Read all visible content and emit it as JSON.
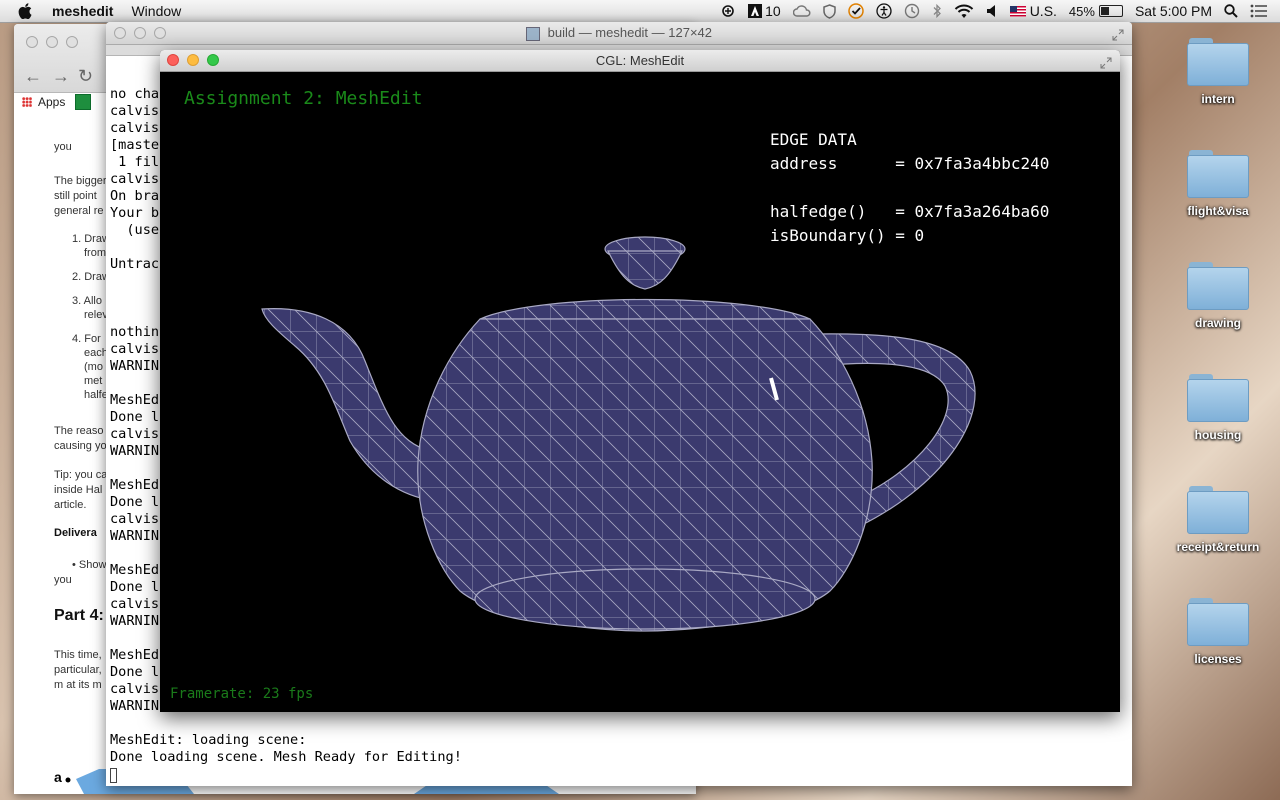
{
  "menubar": {
    "app_name": "meshedit",
    "items": [
      "Window"
    ],
    "status": {
      "adobe_count": "10",
      "input_source": "U.S.",
      "battery": "45%",
      "battery_level": 0.45,
      "clock": "Sat 5:00 PM"
    }
  },
  "desktop": {
    "folders": [
      "intern",
      "flight&visa",
      "drawing",
      "housing",
      "receipt&return",
      "licenses"
    ]
  },
  "browser": {
    "bookmarks_apps": "Apps",
    "lines": [
      "you",
      "The bigger",
      "still point",
      "general re",
      "1. Draw",
      "from",
      "2. Draw",
      "3. Allo",
      "relev",
      "4. For",
      "each",
      "(mo",
      "met",
      "halfe",
      "The reaso",
      "causing yo",
      "Tip: you ca",
      "inside Hal",
      "article.",
      "Delivera",
      "•  Show",
      "you",
      "Part 4:",
      "This time,",
      "particular,",
      "m at its m"
    ],
    "bottom_label": "a"
  },
  "terminal": {
    "title": "build — meshedit — 127×42",
    "lines": [
      "no cha",
      "calvis",
      "calvis",
      "[maste",
      " 1 fil",
      "calvis",
      "On bra",
      "Your b",
      "  (use",
      "",
      "Untrac",
      "",
      "",
      "",
      "nothin",
      "calvis",
      "WARNIN",
      "",
      "MeshEd",
      "Done l",
      "calvis",
      "WARNIN",
      "",
      "MeshEd",
      "Done l",
      "calvis",
      "WARNIN",
      "",
      "MeshEd",
      "Done l",
      "calvis",
      "WARNIN",
      "",
      "MeshEd",
      "Done l",
      "calvis",
      "WARNIN",
      "",
      "MeshEdit: loading scene:",
      "Done loading scene. Mesh Ready for Editing!"
    ]
  },
  "cgl": {
    "title": "CGL: MeshEdit",
    "heading": "Assignment 2: MeshEdit",
    "edge_data": {
      "title": "EDGE DATA",
      "address": "address      = 0x7fa3a4bbc240",
      "halfedge": "halfedge()   = 0x7fa3a264ba60",
      "boundary": "isBoundary() = 0"
    },
    "framerate": "Framerate: 23 fps",
    "mesh_fill": "#3b3a6e",
    "mesh_line": "#a9a9c4"
  }
}
